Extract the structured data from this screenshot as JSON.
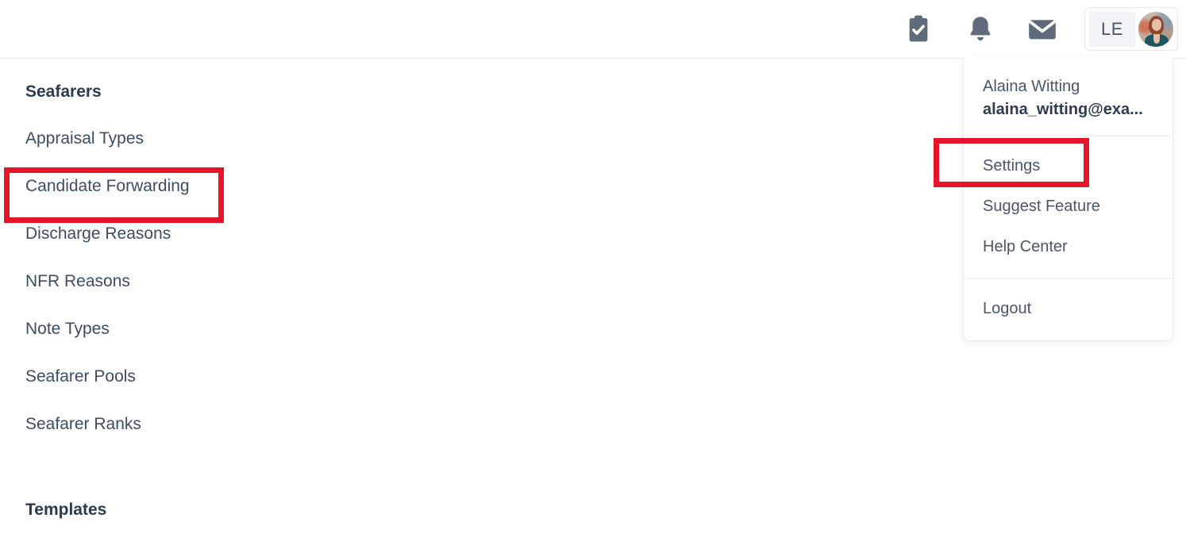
{
  "topbar": {
    "icons": [
      {
        "name": "tasks-icon",
        "label": "Tasks"
      },
      {
        "name": "notifications-icon",
        "label": "Notifications"
      },
      {
        "name": "messages-icon",
        "label": "Messages"
      }
    ],
    "user_chip": {
      "initials": "LE",
      "avatar_alt": "Alaina Witting profile photo"
    }
  },
  "settings_nav": {
    "groups": [
      {
        "title": "Seafarers",
        "items": [
          "Appraisal Types",
          "Candidate Forwarding",
          "Discharge Reasons",
          "NFR Reasons",
          "Note Types",
          "Seafarer Pools",
          "Seafarer Ranks"
        ]
      },
      {
        "title": "Templates",
        "items": []
      }
    ],
    "highlighted_item": "Candidate Forwarding"
  },
  "profile_dropdown": {
    "user_name": "Alaina Witting",
    "user_email": "alaina_witting@exa...",
    "items": [
      "Settings",
      "Suggest Feature",
      "Help Center"
    ],
    "logout_label": "Logout",
    "highlighted_item": "Settings"
  },
  "colors": {
    "annotation_red": "#e8142a",
    "heading_navy": "#2b3a4f",
    "nav_text": "#3c4c63",
    "icon_slate": "#5f6b7a",
    "initials_bg": "#f1f3f6",
    "border_light": "#e7e9ed"
  }
}
